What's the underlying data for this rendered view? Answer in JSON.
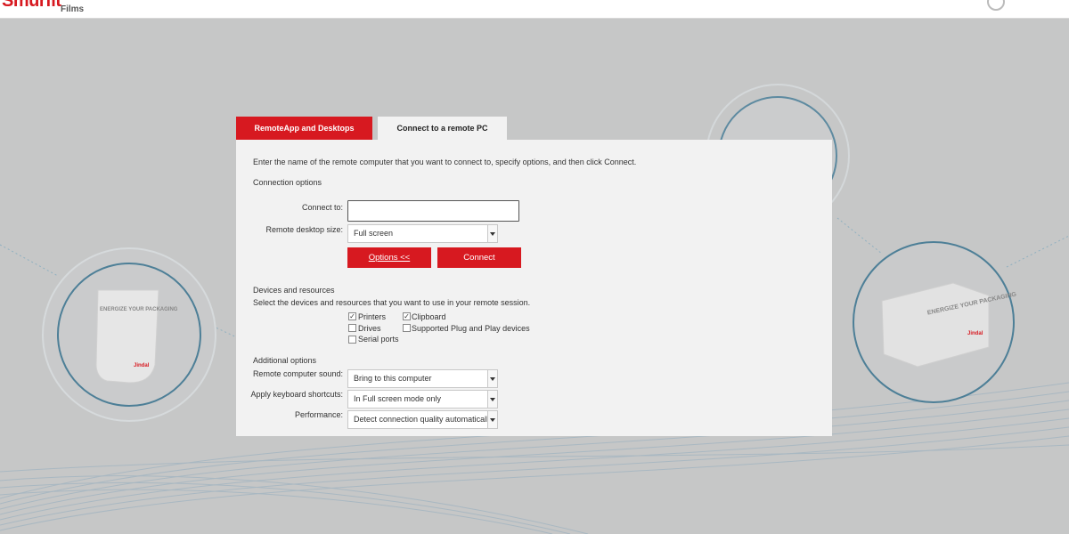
{
  "header": {
    "logo_text": "Smurfit",
    "logo_sub": "Films"
  },
  "tabs": [
    {
      "label": "RemoteApp and Desktops",
      "active": false
    },
    {
      "label": "Connect to a remote PC",
      "active": true
    }
  ],
  "panel": {
    "intro": "Enter the name of the remote computer that you want to connect to, specify options, and then click Connect.",
    "connection_options_heading": "Connection options",
    "connect_to_label": "Connect to:",
    "connect_to_value": "",
    "size_label": "Remote desktop size:",
    "size_value": "Full screen",
    "options_button": "Options <<",
    "connect_button": "Connect",
    "devices_heading": "Devices and resources",
    "devices_intro": "Select the devices and resources that you want to use in your remote session.",
    "devices": {
      "printers": {
        "label": "Printers",
        "checked": true
      },
      "clipboard": {
        "label": "Clipboard",
        "checked": true
      },
      "drives": {
        "label": "Drives",
        "checked": false
      },
      "plug_and_play": {
        "label": "Supported Plug and Play devices",
        "checked": false
      },
      "serial_ports": {
        "label": "Serial ports",
        "checked": false
      }
    },
    "additional_heading": "Additional options",
    "sound_label": "Remote computer sound:",
    "sound_value": "Bring to this computer",
    "keyboard_label": "Apply keyboard shortcuts:",
    "keyboard_value": "In Full screen mode only",
    "performance_label": "Performance:",
    "performance_value": "Detect connection quality automatically"
  },
  "background": {
    "product_text": "ENERGIZE YOUR PACKAGING",
    "brand_mark": "Jindal"
  },
  "colors": {
    "accent": "#d71920",
    "page_bg": "#c6c7c7",
    "panel_bg": "#f2f2f2"
  }
}
